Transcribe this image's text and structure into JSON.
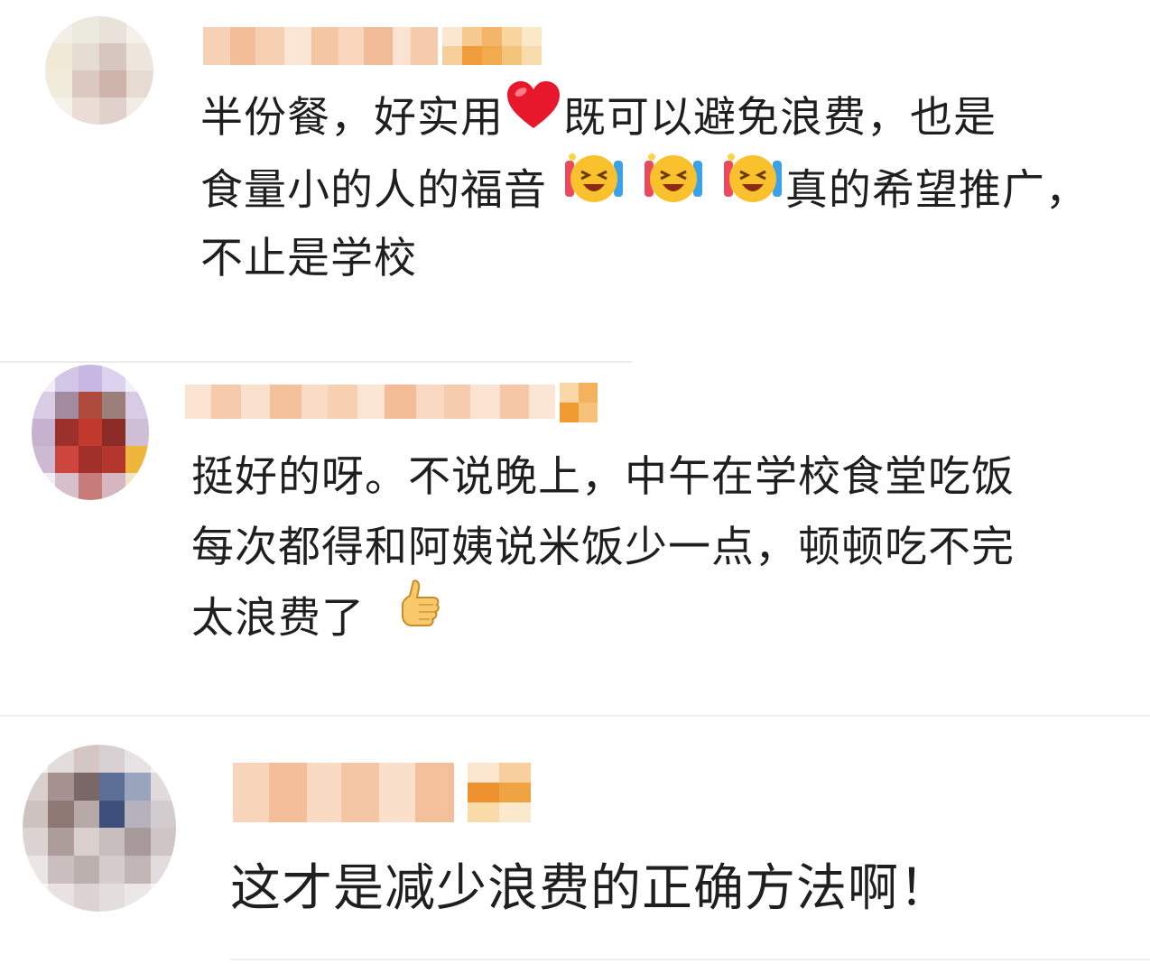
{
  "comments": [
    {
      "lines": [
        "半份餐，好实用",
        "既可以避免浪费，也是",
        "食量小的人的福音",
        "真的希望推广，",
        "不止是学校"
      ]
    },
    {
      "lines": [
        "挺好的呀。不说晚上，中午在学校食堂吃饭",
        "每次都得和阿姨说米饭少一点，顿顿吃不完",
        "太浪费了"
      ]
    },
    {
      "lines": [
        "这才是减少浪费的正确方法啊！"
      ]
    }
  ],
  "icons": {
    "heart": "heart-emoji-icon",
    "laugh_cry": "laugh-cry-emoji-icon",
    "thumbs_up": "thumbs-up-emoji-icon"
  },
  "colors": {
    "name_blur": "#f6c9a8",
    "badge": "#f0a33a",
    "heart": "#e8182c",
    "emoji_face": "#f8c12d"
  }
}
